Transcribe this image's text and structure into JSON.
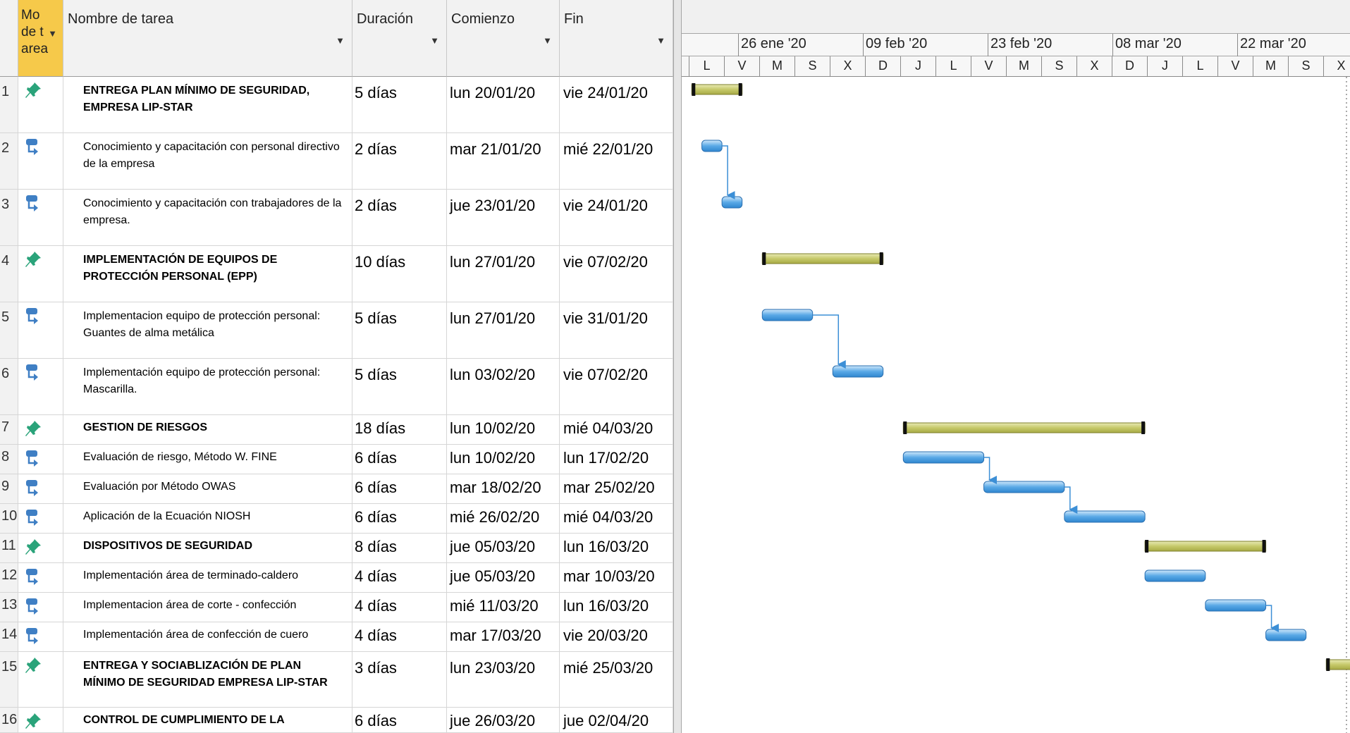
{
  "columns": {
    "mode": "Mo de tarea",
    "name": "Nombre de tarea",
    "duration": "Duración",
    "start": "Comienzo",
    "end": "Fin"
  },
  "tasks": [
    {
      "id": "1",
      "mode": "manual",
      "summary": true,
      "name": "ENTREGA PLAN MÍNIMO DE SEGURIDAD, EMPRESA LIP-STAR",
      "duration": "5 días",
      "start": "lun 20/01/20",
      "end": "vie 24/01/20"
    },
    {
      "id": "2",
      "mode": "auto",
      "summary": false,
      "name": "Conocimiento y capacitación con personal directivo de la empresa",
      "duration": "2 días",
      "start": "mar 21/01/20",
      "end": "mié 22/01/20"
    },
    {
      "id": "3",
      "mode": "auto",
      "summary": false,
      "name": "Conocimiento y capacitación con trabajadores de la empresa.",
      "duration": "2 días",
      "start": "jue 23/01/20",
      "end": "vie 24/01/20"
    },
    {
      "id": "4",
      "mode": "manual",
      "summary": true,
      "name": "IMPLEMENTACIÓN DE EQUIPOS DE PROTECCIÓN PERSONAL (EPP)",
      "duration": "10 días",
      "start": "lun 27/01/20",
      "end": "vie 07/02/20"
    },
    {
      "id": "5",
      "mode": "auto",
      "summary": false,
      "name": "Implementacion equipo de protección personal:  Guantes de alma metálica",
      "duration": "5 días",
      "start": "lun 27/01/20",
      "end": "vie 31/01/20"
    },
    {
      "id": "6",
      "mode": "auto",
      "summary": false,
      "name": "Implementación equipo de protección personal: Mascarilla.",
      "duration": "5 días",
      "start": "lun 03/02/20",
      "end": "vie 07/02/20"
    },
    {
      "id": "7",
      "mode": "manual",
      "summary": true,
      "name": "GESTION DE RIESGOS",
      "duration": "18 días",
      "start": "lun 10/02/20",
      "end": "mié 04/03/20"
    },
    {
      "id": "8",
      "mode": "auto",
      "summary": false,
      "name": "Evaluación de riesgo, Método W. FINE",
      "duration": "6 días",
      "start": "lun 10/02/20",
      "end": "lun 17/02/20"
    },
    {
      "id": "9",
      "mode": "auto",
      "summary": false,
      "name": "Evaluación por Método OWAS",
      "duration": "6 días",
      "start": "mar 18/02/20",
      "end": "mar 25/02/20"
    },
    {
      "id": "10",
      "mode": "auto",
      "summary": false,
      "name": "Aplicación de la Ecuación NIOSH",
      "duration": "6 días",
      "start": "mié 26/02/20",
      "end": "mié 04/03/20"
    },
    {
      "id": "11",
      "mode": "manual",
      "summary": true,
      "name": "DISPOSITIVOS DE SEGURIDAD",
      "duration": "8 días",
      "start": "jue 05/03/20",
      "end": "lun 16/03/20"
    },
    {
      "id": "12",
      "mode": "auto",
      "summary": false,
      "name": "Implementación área de terminado-caldero",
      "duration": "4 días",
      "start": "jue 05/03/20",
      "end": "mar 10/03/20"
    },
    {
      "id": "13",
      "mode": "auto",
      "summary": false,
      "name": "Implementacion área de corte - confección",
      "duration": "4 días",
      "start": "mié 11/03/20",
      "end": "lun 16/03/20"
    },
    {
      "id": "14",
      "mode": "auto",
      "summary": false,
      "name": "Implementación área de confección de cuero",
      "duration": "4 días",
      "start": "mar 17/03/20",
      "end": "vie 20/03/20"
    },
    {
      "id": "15",
      "mode": "manual",
      "summary": true,
      "name": "ENTREGA Y SOCIABLIZACIÓN DE PLAN MÍNIMO DE SEGURIDAD EMPRESA LIP-STAR",
      "duration": "3 días",
      "start": "lun 23/03/20",
      "end": "mié 25/03/20"
    },
    {
      "id": "16",
      "mode": "manual",
      "summary": true,
      "name": "CONTROL DE CUMPLIMIENTO DE LA PROPUESTA",
      "duration": "6 días",
      "start": "jue 26/03/20",
      "end": "jue 02/04/20"
    }
  ],
  "timescale": {
    "weeks": [
      "26 ene '20",
      "09 feb '20",
      "23 feb '20",
      "08 mar '20",
      "22 mar '20"
    ],
    "days": [
      "L",
      "V",
      "M",
      "S",
      "X",
      "D",
      "J",
      "L",
      "V",
      "M",
      "S",
      "X",
      "D",
      "J",
      "L",
      "V",
      "M",
      "S",
      "X"
    ]
  },
  "gantt": {
    "bars": [
      {
        "task": 1,
        "type": "manual",
        "start": "2020-01-20",
        "end": "2020-01-24"
      },
      {
        "task": 2,
        "type": "auto",
        "start": "2020-01-21",
        "end": "2020-01-22"
      },
      {
        "task": 3,
        "type": "auto",
        "start": "2020-01-23",
        "end": "2020-01-24"
      },
      {
        "task": 4,
        "type": "manual",
        "start": "2020-01-27",
        "end": "2020-02-07"
      },
      {
        "task": 5,
        "type": "auto",
        "start": "2020-01-27",
        "end": "2020-01-31"
      },
      {
        "task": 6,
        "type": "auto",
        "start": "2020-02-03",
        "end": "2020-02-07"
      },
      {
        "task": 7,
        "type": "manual",
        "start": "2020-02-10",
        "end": "2020-03-04"
      },
      {
        "task": 8,
        "type": "auto",
        "start": "2020-02-10",
        "end": "2020-02-17"
      },
      {
        "task": 9,
        "type": "auto",
        "start": "2020-02-18",
        "end": "2020-02-25"
      },
      {
        "task": 10,
        "type": "auto",
        "start": "2020-02-26",
        "end": "2020-03-04"
      },
      {
        "task": 11,
        "type": "manual",
        "start": "2020-03-05",
        "end": "2020-03-16"
      },
      {
        "task": 12,
        "type": "auto",
        "start": "2020-03-05",
        "end": "2020-03-10"
      },
      {
        "task": 13,
        "type": "auto",
        "start": "2020-03-11",
        "end": "2020-03-16"
      },
      {
        "task": 14,
        "type": "auto",
        "start": "2020-03-17",
        "end": "2020-03-20"
      },
      {
        "task": 15,
        "type": "manual",
        "start": "2020-03-23",
        "end": "2020-03-25"
      },
      {
        "task": 16,
        "type": "manual",
        "start": "2020-03-26",
        "end": "2020-04-02"
      }
    ],
    "links": [
      [
        2,
        3
      ],
      [
        5,
        6
      ],
      [
        8,
        9
      ],
      [
        9,
        10
      ],
      [
        13,
        14
      ]
    ]
  },
  "colors": {
    "manual_bar": "#c6c96a",
    "auto_bar": "#5aa9e6",
    "link": "#3c8fd6",
    "mode_header": "#f6c94a",
    "pin_icon": "#2aa37a",
    "auto_icon": "#3f7fc4"
  },
  "icons": {
    "manual": "pushpin-icon",
    "auto": "auto-schedule-icon",
    "dropdown": "dropdown-arrow-icon"
  }
}
